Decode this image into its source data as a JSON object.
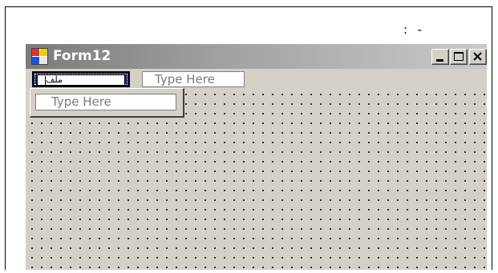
{
  "page": {
    "marks": ":  -"
  },
  "window": {
    "title": "Form12",
    "icon": "form-icon",
    "controls": {
      "minimize_icon": "minimize-icon",
      "maximize_icon": "maximize-icon",
      "close_icon": "close-icon"
    }
  },
  "menu": {
    "selected_item_value": "ملف",
    "type_here_label": "Type Here"
  },
  "dropdown": {
    "type_here_label": "Type Here"
  },
  "colors": {
    "selection": "#0a246a",
    "surface": "#d4d0c8",
    "placeholder_text": "#7a7a7a"
  }
}
